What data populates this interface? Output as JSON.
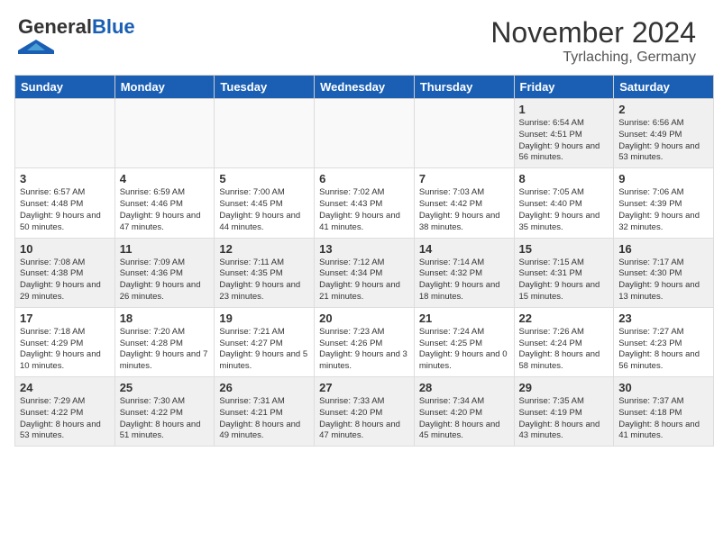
{
  "header": {
    "logo_general": "General",
    "logo_blue": "Blue",
    "main_title": "November 2024",
    "subtitle": "Tyrlaching, Germany"
  },
  "columns": [
    "Sunday",
    "Monday",
    "Tuesday",
    "Wednesday",
    "Thursday",
    "Friday",
    "Saturday"
  ],
  "weeks": [
    [
      {
        "day": "",
        "info": ""
      },
      {
        "day": "",
        "info": ""
      },
      {
        "day": "",
        "info": ""
      },
      {
        "day": "",
        "info": ""
      },
      {
        "day": "",
        "info": ""
      },
      {
        "day": "1",
        "info": "Sunrise: 6:54 AM\nSunset: 4:51 PM\nDaylight: 9 hours and 56 minutes."
      },
      {
        "day": "2",
        "info": "Sunrise: 6:56 AM\nSunset: 4:49 PM\nDaylight: 9 hours and 53 minutes."
      }
    ],
    [
      {
        "day": "3",
        "info": "Sunrise: 6:57 AM\nSunset: 4:48 PM\nDaylight: 9 hours and 50 minutes."
      },
      {
        "day": "4",
        "info": "Sunrise: 6:59 AM\nSunset: 4:46 PM\nDaylight: 9 hours and 47 minutes."
      },
      {
        "day": "5",
        "info": "Sunrise: 7:00 AM\nSunset: 4:45 PM\nDaylight: 9 hours and 44 minutes."
      },
      {
        "day": "6",
        "info": "Sunrise: 7:02 AM\nSunset: 4:43 PM\nDaylight: 9 hours and 41 minutes."
      },
      {
        "day": "7",
        "info": "Sunrise: 7:03 AM\nSunset: 4:42 PM\nDaylight: 9 hours and 38 minutes."
      },
      {
        "day": "8",
        "info": "Sunrise: 7:05 AM\nSunset: 4:40 PM\nDaylight: 9 hours and 35 minutes."
      },
      {
        "day": "9",
        "info": "Sunrise: 7:06 AM\nSunset: 4:39 PM\nDaylight: 9 hours and 32 minutes."
      }
    ],
    [
      {
        "day": "10",
        "info": "Sunrise: 7:08 AM\nSunset: 4:38 PM\nDaylight: 9 hours and 29 minutes."
      },
      {
        "day": "11",
        "info": "Sunrise: 7:09 AM\nSunset: 4:36 PM\nDaylight: 9 hours and 26 minutes."
      },
      {
        "day": "12",
        "info": "Sunrise: 7:11 AM\nSunset: 4:35 PM\nDaylight: 9 hours and 23 minutes."
      },
      {
        "day": "13",
        "info": "Sunrise: 7:12 AM\nSunset: 4:34 PM\nDaylight: 9 hours and 21 minutes."
      },
      {
        "day": "14",
        "info": "Sunrise: 7:14 AM\nSunset: 4:32 PM\nDaylight: 9 hours and 18 minutes."
      },
      {
        "day": "15",
        "info": "Sunrise: 7:15 AM\nSunset: 4:31 PM\nDaylight: 9 hours and 15 minutes."
      },
      {
        "day": "16",
        "info": "Sunrise: 7:17 AM\nSunset: 4:30 PM\nDaylight: 9 hours and 13 minutes."
      }
    ],
    [
      {
        "day": "17",
        "info": "Sunrise: 7:18 AM\nSunset: 4:29 PM\nDaylight: 9 hours and 10 minutes."
      },
      {
        "day": "18",
        "info": "Sunrise: 7:20 AM\nSunset: 4:28 PM\nDaylight: 9 hours and 7 minutes."
      },
      {
        "day": "19",
        "info": "Sunrise: 7:21 AM\nSunset: 4:27 PM\nDaylight: 9 hours and 5 minutes."
      },
      {
        "day": "20",
        "info": "Sunrise: 7:23 AM\nSunset: 4:26 PM\nDaylight: 9 hours and 3 minutes."
      },
      {
        "day": "21",
        "info": "Sunrise: 7:24 AM\nSunset: 4:25 PM\nDaylight: 9 hours and 0 minutes."
      },
      {
        "day": "22",
        "info": "Sunrise: 7:26 AM\nSunset: 4:24 PM\nDaylight: 8 hours and 58 minutes."
      },
      {
        "day": "23",
        "info": "Sunrise: 7:27 AM\nSunset: 4:23 PM\nDaylight: 8 hours and 56 minutes."
      }
    ],
    [
      {
        "day": "24",
        "info": "Sunrise: 7:29 AM\nSunset: 4:22 PM\nDaylight: 8 hours and 53 minutes."
      },
      {
        "day": "25",
        "info": "Sunrise: 7:30 AM\nSunset: 4:22 PM\nDaylight: 8 hours and 51 minutes."
      },
      {
        "day": "26",
        "info": "Sunrise: 7:31 AM\nSunset: 4:21 PM\nDaylight: 8 hours and 49 minutes."
      },
      {
        "day": "27",
        "info": "Sunrise: 7:33 AM\nSunset: 4:20 PM\nDaylight: 8 hours and 47 minutes."
      },
      {
        "day": "28",
        "info": "Sunrise: 7:34 AM\nSunset: 4:20 PM\nDaylight: 8 hours and 45 minutes."
      },
      {
        "day": "29",
        "info": "Sunrise: 7:35 AM\nSunset: 4:19 PM\nDaylight: 8 hours and 43 minutes."
      },
      {
        "day": "30",
        "info": "Sunrise: 7:37 AM\nSunset: 4:18 PM\nDaylight: 8 hours and 41 minutes."
      }
    ]
  ]
}
